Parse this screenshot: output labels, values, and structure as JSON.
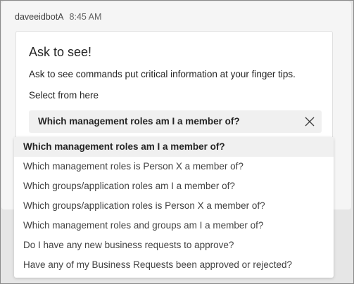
{
  "message": {
    "sender": "daveeidbotA",
    "time": "8:45 AM"
  },
  "card": {
    "title": "Ask to see!",
    "description": "Ask to see commands put critical information at your finger tips.",
    "select_label": "Select from here",
    "selected_value": "Which management roles am I a member of?",
    "clear_icon": "close-icon"
  },
  "dropdown": {
    "options": [
      "Which management roles am I a member of?",
      "Which management roles is Person X a member of?",
      "Which groups/application roles am I a member of?",
      "Which groups/application roles is Person X a member of?",
      "Which management roles and groups am I a member of?",
      "Do I have any new business requests to approve?",
      "Have any of my Business Requests been approved or rejected?"
    ],
    "selected_index": 0
  },
  "colors": {
    "background": "#e6e6e6",
    "message_bg": "#f5f5f5",
    "card_bg": "#ffffff",
    "input_bg": "#f0f0f0",
    "text": "#242424"
  }
}
